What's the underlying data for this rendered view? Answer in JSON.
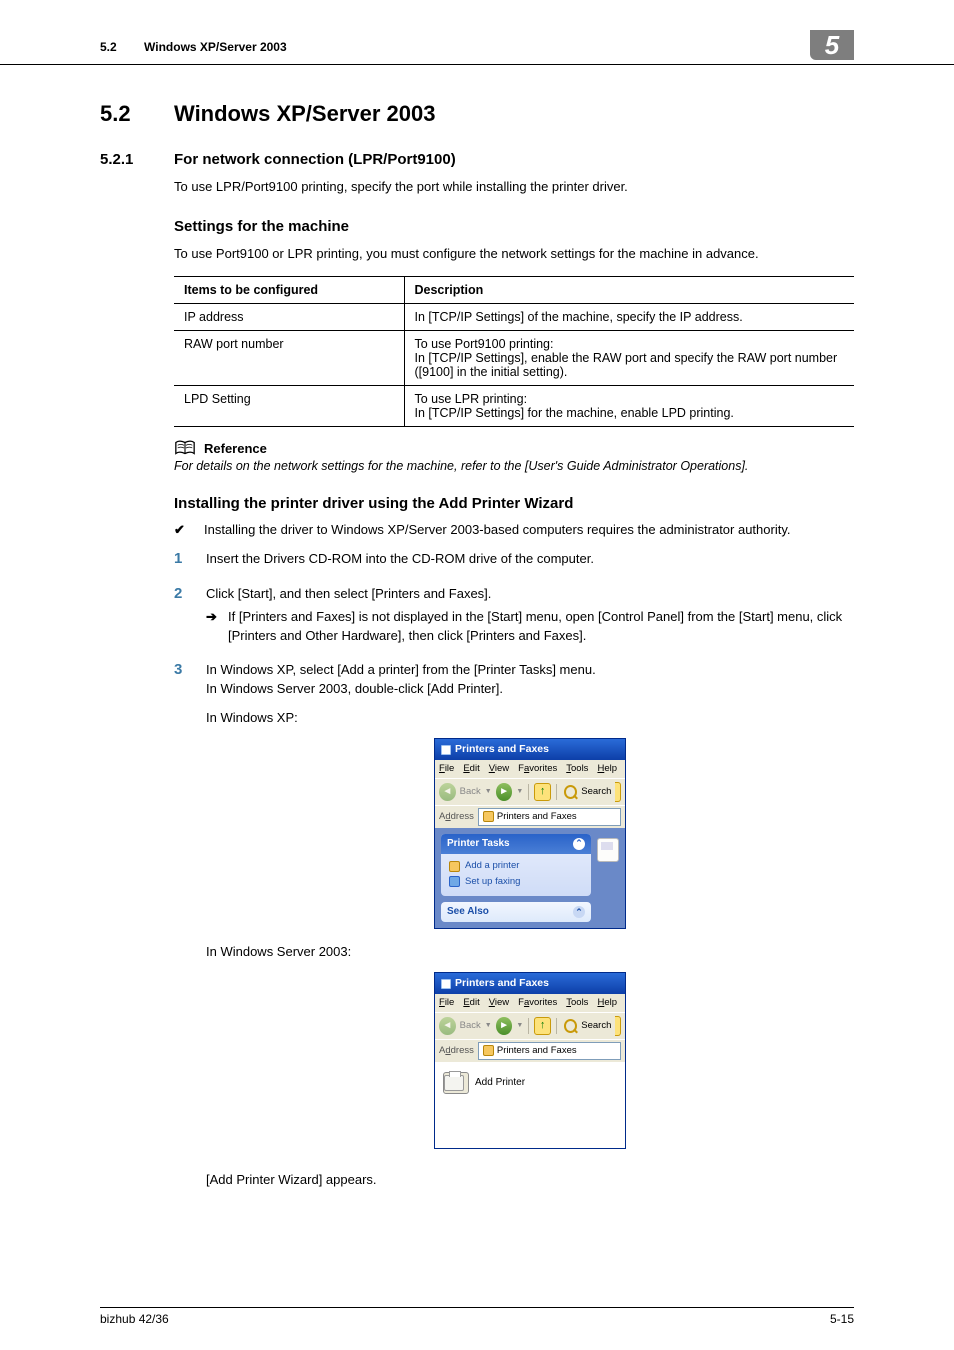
{
  "header": {
    "section_num": "5.2",
    "section_title": "Windows XP/Server 2003",
    "chapter_badge": "5"
  },
  "h1": {
    "num": "5.2",
    "text": "Windows XP/Server 2003"
  },
  "h2": {
    "num": "5.2.1",
    "text": "For network connection (LPR/Port9100)"
  },
  "intro1": "To use LPR/Port9100 printing, specify the port while installing the printer driver.",
  "h3_settings": "Settings for the machine",
  "intro2": "To use Port9100 or LPR printing, you must configure the network settings for the machine in advance.",
  "table": {
    "head": {
      "c1": "Items to be configured",
      "c2": "Description"
    },
    "rows": [
      {
        "c1": "IP address",
        "c2": "In [TCP/IP Settings] of the machine, specify the IP address."
      },
      {
        "c1": "RAW port number",
        "c2": "To use Port9100 printing:\nIn [TCP/IP Settings], enable the RAW port and specify the RAW port number ([9100] in the initial setting)."
      },
      {
        "c1": "LPD Setting",
        "c2": "To use LPR printing:\n In [TCP/IP Settings] for the machine, enable LPD printing."
      }
    ]
  },
  "reference": {
    "label": "Reference",
    "text": "For details on the network settings for the machine, refer to the [User's Guide Administrator Operations]."
  },
  "h3_install": "Installing the printer driver using the Add Printer Wizard",
  "check_note": "Installing the driver to Windows XP/Server 2003-based computers requires the administrator authority.",
  "steps": {
    "s1": "Insert the Drivers CD-ROM into the CD-ROM drive of the computer.",
    "s2": "Click [Start], and then select [Printers and Faxes].",
    "s2_sub": "If [Printers and Faxes] is not displayed in the [Start] menu, open [Control Panel] from the [Start] menu, click [Printers and Other Hardware], then click [Printers and Faxes].",
    "s3a": "In Windows XP, select [Add a printer] from the [Printer Tasks] menu.",
    "s3b": "In Windows Server 2003, double-click [Add Printer].",
    "s3_cap_xp": "In Windows XP:",
    "s3_cap_ws": "In Windows Server 2003:",
    "s3_after": "[Add Printer Wizard] appears."
  },
  "xp_window": {
    "title": "Printers and Faxes",
    "menu": {
      "file": "File",
      "edit": "Edit",
      "view": "View",
      "fav": "Favorites",
      "tools": "Tools",
      "help": "Help"
    },
    "toolbar": {
      "back": "Back",
      "search": "Search"
    },
    "address_label": "Address",
    "address_value": "Printers and Faxes",
    "panel_tasks_title": "Printer Tasks",
    "task_add": "Add a printer",
    "task_fax": "Set up faxing",
    "panel_seealso_title": "See Also"
  },
  "ws_window": {
    "title": "Printers and Faxes",
    "menu": {
      "file": "File",
      "edit": "Edit",
      "view": "View",
      "fav": "Favorites",
      "tools": "Tools",
      "help": "Help"
    },
    "toolbar": {
      "back": "Back",
      "search": "Search"
    },
    "address_label": "Address",
    "address_value": "Printers and Faxes",
    "add_printer_label": "Add Printer"
  },
  "footer": {
    "left": "bizhub 42/36",
    "right": "5-15"
  }
}
